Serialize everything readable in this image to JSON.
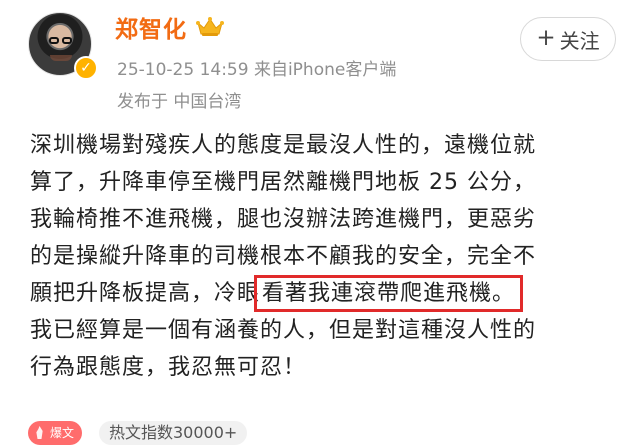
{
  "profile": {
    "name": "郑智化",
    "timestamp_source": "25-10-25 14:59  来自iPhone客户端",
    "location": "发布于 中国台湾",
    "brand_color": "#f26b13"
  },
  "actions": {
    "follow_label": "关注",
    "follow_icon": "plus-icon"
  },
  "post": {
    "lines": [
      {
        "text": "深圳機場對殘疾人的態度是最沒人性的，遠機位就"
      },
      {
        "text": "算了，升降車停至機門居然離機門地板 25 公分，"
      },
      {
        "text": "我輪椅推不進飛機，腿也沒辦法跨進機門，更惡劣"
      },
      {
        "text": "的是操縱升降車的司機根本不顧我的安全，完全不"
      },
      {
        "before": "願把升降板提高，冷眼",
        "highlight": "看著我連滾帶爬進飛機。"
      },
      {
        "text": "我已經算是一個有涵養的人，但是對這種沒人性的"
      },
      {
        "text": "行為跟態度，我忍無可忍！"
      }
    ],
    "highlight_color": "#e12a2a"
  },
  "footer": {
    "badge_label": "爆文",
    "hot_index": "热文指数30000+"
  },
  "icons": {
    "verified": "verified-badge-icon",
    "crown": "crown-icon",
    "fire": "fire-icon"
  }
}
